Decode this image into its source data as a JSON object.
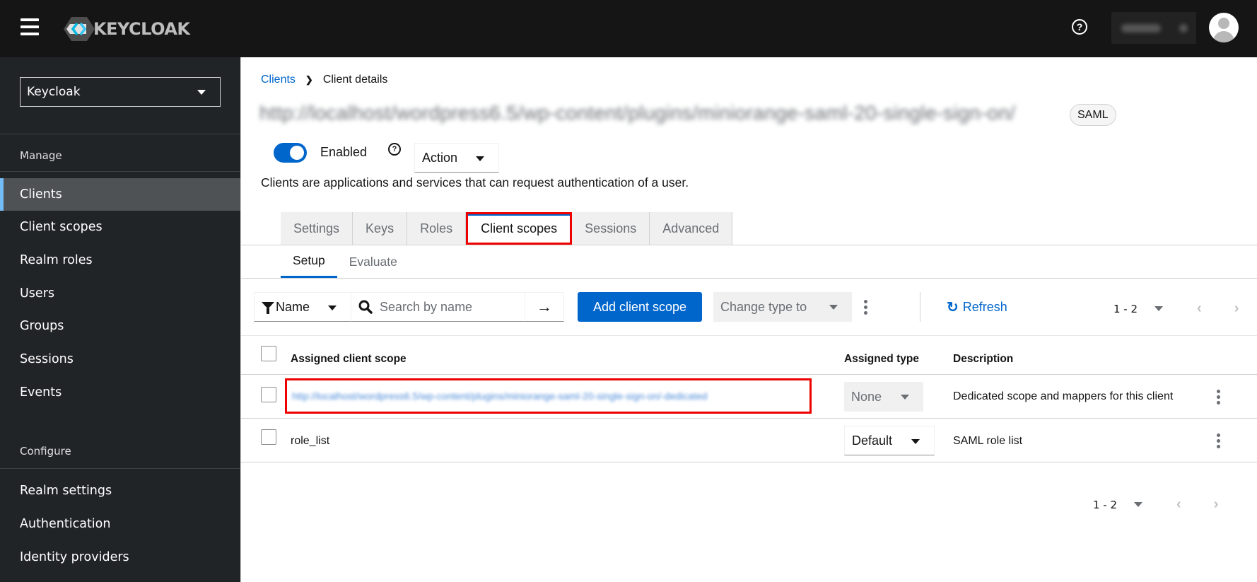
{
  "masthead": {
    "brand": "KEYCLOAK",
    "help_icon": "question-circle-icon",
    "user_menu_label": "admin"
  },
  "sidebar": {
    "realm": "Keycloak",
    "manage_heading": "Manage",
    "manage_items": [
      {
        "label": "Clients",
        "active": true
      },
      {
        "label": "Client scopes"
      },
      {
        "label": "Realm roles"
      },
      {
        "label": "Users"
      },
      {
        "label": "Groups"
      },
      {
        "label": "Sessions"
      },
      {
        "label": "Events"
      }
    ],
    "configure_heading": "Configure",
    "configure_items": [
      {
        "label": "Realm settings"
      },
      {
        "label": "Authentication"
      },
      {
        "label": "Identity providers"
      }
    ]
  },
  "breadcrumb": {
    "parent": "Clients",
    "current": "Client details"
  },
  "client": {
    "title": "http://localhost/wordpress6.5/wp-content/plugins/miniorange-saml-20-single-sign-on/",
    "protocol_badge": "SAML",
    "enabled_label": "Enabled",
    "enabled": true,
    "action_label": "Action",
    "description": "Clients are applications and services that can request authentication of a user."
  },
  "tabs": [
    {
      "label": "Settings"
    },
    {
      "label": "Keys"
    },
    {
      "label": "Roles"
    },
    {
      "label": "Client scopes",
      "active": true
    },
    {
      "label": "Sessions"
    },
    {
      "label": "Advanced"
    }
  ],
  "subtabs": [
    {
      "label": "Setup",
      "active": true
    },
    {
      "label": "Evaluate"
    }
  ],
  "toolbar": {
    "filter_label": "Name",
    "search_placeholder": "Search by name",
    "add_label": "Add client scope",
    "change_type_label": "Change type to",
    "refresh_label": "Refresh",
    "pagination": "1 - 2"
  },
  "table": {
    "headers": {
      "scope": "Assigned client scope",
      "type": "Assigned type",
      "description": "Description"
    },
    "rows": [
      {
        "scope": "http://localhost/wordpress6.5/wp-content/plugins/miniorange-saml-20-single-sign-on/-dedicated",
        "type": "None",
        "type_disabled": true,
        "description": "Dedicated scope and mappers for this client"
      },
      {
        "scope": "role_list",
        "type": "Default",
        "type_disabled": false,
        "description": "SAML role list"
      }
    ]
  },
  "footer": {
    "pagination": "1 - 2"
  },
  "colors": {
    "accent": "#0066cc",
    "masthead_bg": "#151515",
    "sidebar_bg": "#212427",
    "highlight_box": "#ee0000",
    "active_nav_marker": "#73bcf7"
  }
}
